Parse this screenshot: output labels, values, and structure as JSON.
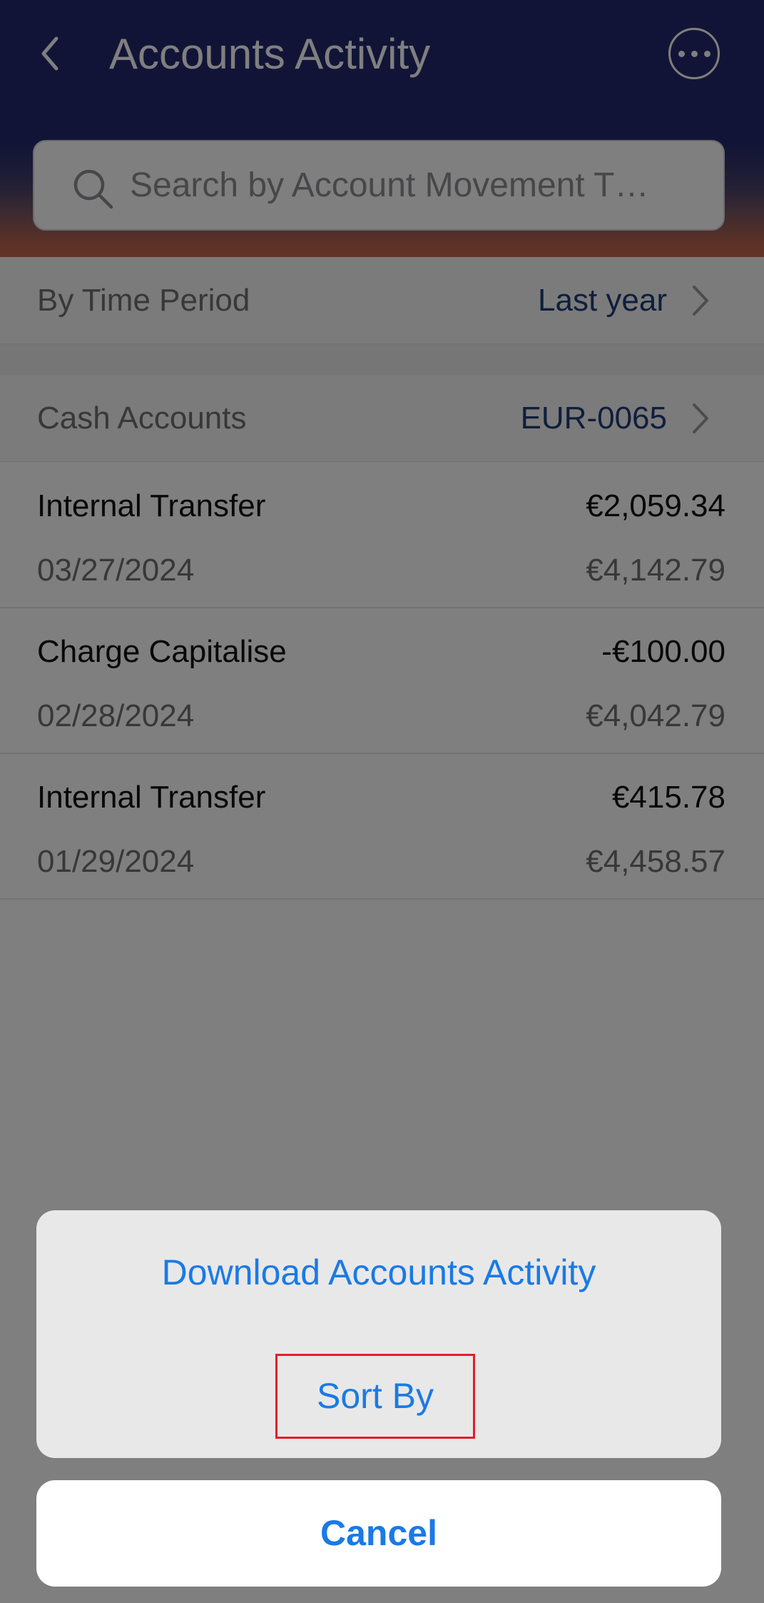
{
  "header": {
    "title": "Accounts Activity",
    "back_icon": "chevron-left-icon",
    "more_icon": "more-horizontal-icon"
  },
  "search": {
    "placeholder": "Search by Account Movement T…",
    "icon": "search-icon"
  },
  "filters": {
    "time_period": {
      "label": "By Time Period",
      "value": "Last year"
    },
    "cash_accounts": {
      "label": "Cash Accounts",
      "value": "EUR-0065"
    }
  },
  "transactions": [
    {
      "title": "Internal Transfer",
      "amount": "€2,059.34",
      "date": "03/27/2024",
      "balance": "€4,142.79"
    },
    {
      "title": "Charge Capitalise",
      "amount": "-€100.00",
      "date": "02/28/2024",
      "balance": "€4,042.79"
    },
    {
      "title": "Internal Transfer",
      "amount": "€415.78",
      "date": "01/29/2024",
      "balance": "€4,458.57"
    }
  ],
  "action_sheet": {
    "download_label": "Download Accounts Activity",
    "sort_label": "Sort By",
    "cancel_label": "Cancel"
  },
  "colors": {
    "header_navy": "#24296e",
    "header_sunset": "#c76a4a",
    "accent_blue": "#1a7ae6",
    "link_navy": "#1f3c7a",
    "highlight_red": "#e0202c"
  }
}
